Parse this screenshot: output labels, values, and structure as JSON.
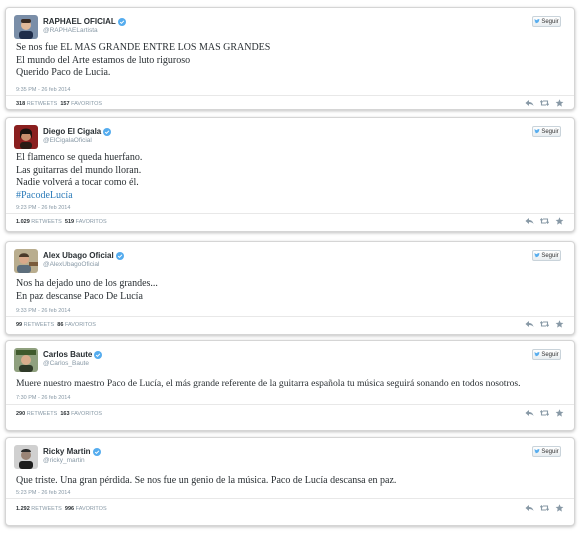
{
  "follow_label": "Seguir",
  "colors": {
    "verified": "#55acee",
    "link": "#2b7bb9",
    "muted": "#8899a6"
  },
  "tweets": [
    {
      "name": "RAPHAEL OFICIAL",
      "handle": "@RAPHAELartista",
      "lines": [
        "Se nos fue EL MAS GRANDE ENTRE LOS MAS GRANDES",
        "El mundo del Arte estamos de luto riguroso",
        "Querido Paco de Lucia."
      ],
      "timestamp": "9:35 PM - 26 feb 2014",
      "retweets": "318",
      "retweets_label": "RETWEETS",
      "favorites": "157",
      "favorites_label": "FAVORITOS",
      "avatar": "person-photo"
    },
    {
      "name": "Diego El Cigala",
      "handle": "@ElCigalaOficial",
      "lines": [
        "El flamenco se queda huerfano.",
        "Las guitarras del mundo lloran.",
        "Nadie volverá a tocar como él."
      ],
      "hashtag": "#PacodeLucía",
      "timestamp": "9:23 PM - 26 feb 2014",
      "retweets": "1.029",
      "retweets_label": "RETWEETS",
      "favorites": "519",
      "favorites_label": "FAVORITOS",
      "avatar": "person-photo"
    },
    {
      "name": "Alex Ubago Oficial",
      "handle": "@AlexUbagoOficial",
      "lines": [
        "Nos ha dejado uno de los grandes...",
        "En paz descanse Paco De Lucía"
      ],
      "timestamp": "9:33 PM - 26 feb 2014",
      "retweets": "99",
      "retweets_label": "RETWEETS",
      "favorites": "86",
      "favorites_label": "FAVORITOS",
      "avatar": "person-photo"
    },
    {
      "name": "Carlos Baute",
      "handle": "@Carlos_Baute",
      "lines": [
        "Muere nuestro maestro Paco de Lucía, el más grande referente de la guitarra española tu música seguirá sonando en todos nosotros."
      ],
      "timestamp": "7:30 PM - 26 feb 2014",
      "retweets": "290",
      "retweets_label": "RETWEETS",
      "favorites": "163",
      "favorites_label": "FAVORITOS",
      "avatar": "person-photo"
    },
    {
      "name": "Ricky Martin",
      "handle": "@ricky_martin",
      "lines": [
        "Que triste. Una gran pérdida. Se nos fue un genio de la música. Paco de Lucía descansa en paz."
      ],
      "timestamp": "5:23 PM - 26 feb 2014",
      "retweets": "1.292",
      "retweets_label": "RETWEETS",
      "favorites": "996",
      "favorites_label": "FAVORITOS",
      "avatar": "person-photo"
    }
  ]
}
